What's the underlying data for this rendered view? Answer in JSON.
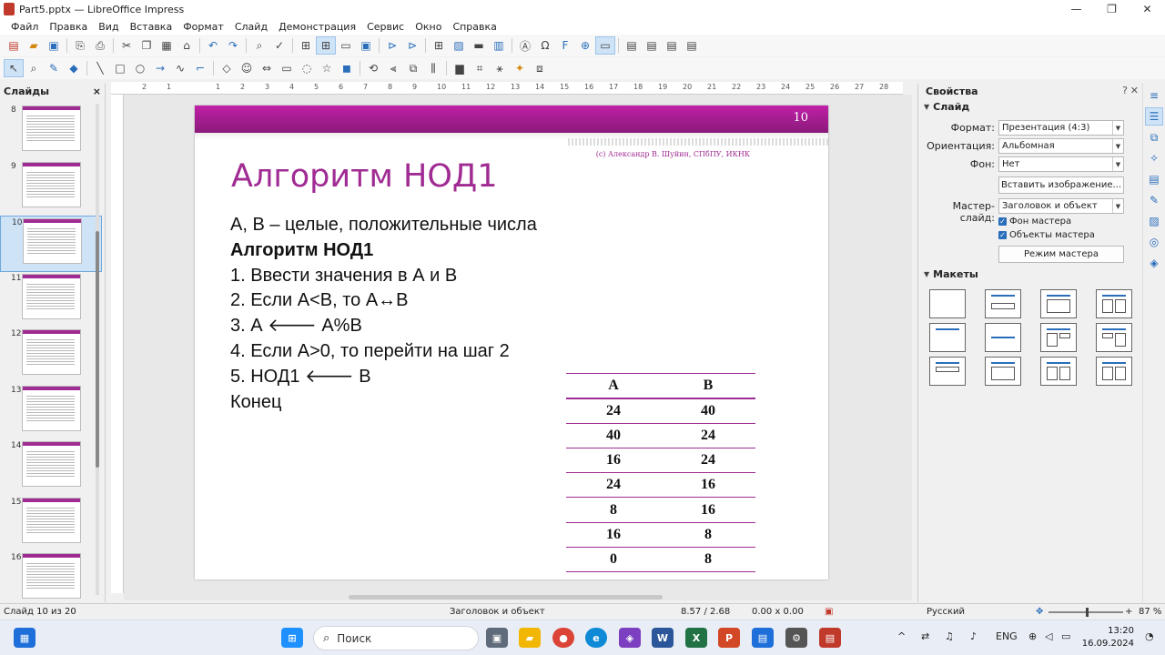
{
  "window": {
    "title": "Part5.pptx — LibreOffice Impress",
    "controls": [
      "—",
      "❐",
      "✕"
    ]
  },
  "menu": [
    "Файл",
    "Правка",
    "Вид",
    "Вставка",
    "Формат",
    "Слайд",
    "Демонстрация",
    "Сервис",
    "Окно",
    "Справка"
  ],
  "slides_panel": {
    "title": "Слайды",
    "close": "×",
    "thumbnails": [
      {
        "number": "8"
      },
      {
        "number": "9"
      },
      {
        "number": "10"
      },
      {
        "number": "11"
      },
      {
        "number": "12"
      },
      {
        "number": "13"
      },
      {
        "number": "14"
      },
      {
        "number": "15"
      },
      {
        "number": "16"
      }
    ],
    "selected_number": "10"
  },
  "ruler": {
    "ticks": [
      "2",
      "1",
      "1",
      "2",
      "3",
      "4",
      "5",
      "6",
      "7",
      "8",
      "9",
      "10",
      "11",
      "12",
      "13",
      "14",
      "15",
      "16",
      "17",
      "18",
      "19",
      "20",
      "21",
      "22",
      "23",
      "24",
      "25",
      "26",
      "27",
      "28"
    ]
  },
  "slide": {
    "number": "10",
    "copyright": "(c) Александр В. Шуйин, СПбПУ, ИКНК",
    "title": "Алгоритм НОД1",
    "lines": [
      "A, B – целые, положительные числа",
      "Алгоритм НОД1",
      "1. Ввести значения в А и В",
      "2. Если A<B, то A↔B",
      "3. А 🡐 A%B",
      "4. Если A>0, то перейти на шаг 2",
      "5. НОД1 🡐 B",
      "Конец"
    ],
    "table": {
      "headers": [
        "A",
        "B"
      ],
      "rows": [
        [
          "24",
          "40"
        ],
        [
          "40",
          "24"
        ],
        [
          "16",
          "24"
        ],
        [
          "24",
          "16"
        ],
        [
          "8",
          "16"
        ],
        [
          "16",
          "8"
        ],
        [
          "0",
          "8"
        ]
      ]
    }
  },
  "sidebar": {
    "title": "Свойства",
    "help": "?",
    "close": "✕",
    "slide_section": "Слайд",
    "format_label": "Формат:",
    "format_value": "Презентация (4:3)",
    "orientation_label": "Ориентация:",
    "orientation_value": "Альбомная",
    "background_label": "Фон:",
    "background_value": "Нет",
    "insert_image_button": "Вставить изображение...",
    "master_label": "Мастер-слайд:",
    "master_value": "Заголовок и объект",
    "master_bg_check": "Фон мастера",
    "master_objects_check": "Объекты мастера",
    "master_mode_button": "Режим мастера",
    "layouts_section": "Макеты"
  },
  "statusbar": {
    "slide_info": "Слайд 10 из 20",
    "layout_name": "Заголовок и объект",
    "position": "8.57 / 2.68",
    "size": "0.00 x 0.00",
    "language": "Русский",
    "zoom": "87 %"
  },
  "taskbar": {
    "search_placeholder": "Поиск",
    "language": "ENG",
    "time": "13:20",
    "date": "16.09.2024"
  }
}
